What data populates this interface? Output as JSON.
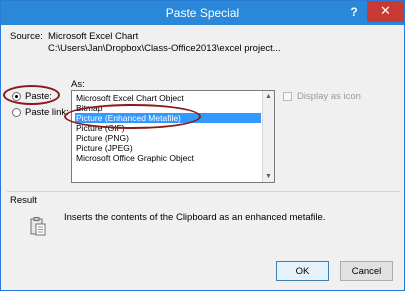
{
  "title": "Paste Special",
  "controls": {
    "help": "?",
    "close": "✕"
  },
  "source": {
    "label": "Source:",
    "name": "Microsoft Excel Chart",
    "path": "C:\\Users\\Jan\\Dropbox\\Class-Office2013\\excel project..."
  },
  "as_label": "As:",
  "options": {
    "paste": "Paste:",
    "paste_link": "Paste link:",
    "selected": "paste"
  },
  "list": {
    "items": [
      "Microsoft Excel Chart Object",
      "Bitmap",
      "Picture (Enhanced Metafile)",
      "Picture (GIF)",
      "Picture (PNG)",
      "Picture (JPEG)",
      "Microsoft Office Graphic Object"
    ],
    "selected_index": 2
  },
  "display_as_icon": "Display as icon",
  "result": {
    "label": "Result",
    "text": "Inserts the contents of the Clipboard as an enhanced metafile."
  },
  "buttons": {
    "ok": "OK",
    "cancel": "Cancel"
  },
  "colors": {
    "titlebar": "#2b88d8",
    "close": "#c83a33",
    "selection": "#3399ff",
    "annotation": "#8b1a1a"
  }
}
